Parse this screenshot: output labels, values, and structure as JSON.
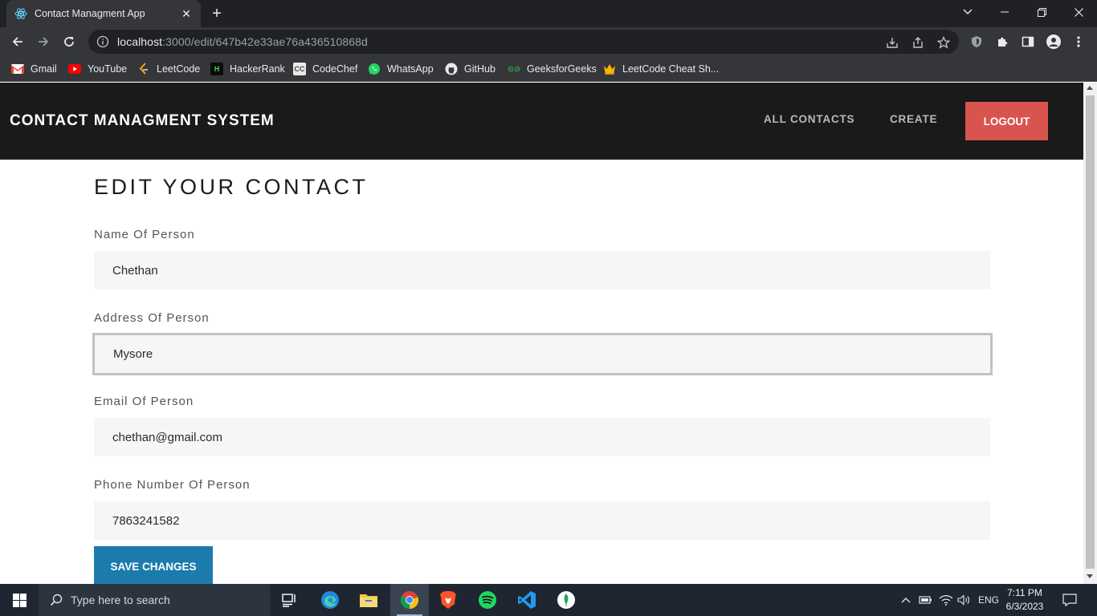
{
  "browser": {
    "tab_title": "Contact Managment App",
    "url_host": "localhost",
    "url_rest": ":3000/edit/647b42e33ae76a436510868d",
    "bookmarks": [
      {
        "label": "Gmail",
        "icon": "gmail-icon"
      },
      {
        "label": "YouTube",
        "icon": "youtube-icon"
      },
      {
        "label": "LeetCode",
        "icon": "leetcode-icon"
      },
      {
        "label": "HackerRank",
        "icon": "hackerrank-icon"
      },
      {
        "label": "CodeChef",
        "icon": "codechef-icon"
      },
      {
        "label": "WhatsApp",
        "icon": "whatsapp-icon"
      },
      {
        "label": "GitHub",
        "icon": "github-icon"
      },
      {
        "label": "GeeksforGeeks",
        "icon": "geeksforgeeks-icon"
      },
      {
        "label": "LeetCode Cheat Sh...",
        "icon": "crown-icon"
      }
    ]
  },
  "app": {
    "brand": "CONTACT MANAGMENT SYSTEM",
    "nav": {
      "all_contacts": "ALL CONTACTS",
      "create": "CREATE",
      "logout": "LOGOUT"
    },
    "colors": {
      "header_bg": "#1a1a1a",
      "logout_bg": "#d9534f",
      "save_bg": "#1c7bad"
    }
  },
  "form": {
    "heading": "EDIT YOUR CONTACT",
    "name_label": "Name Of Person",
    "name_value": "Chethan",
    "address_label": "Address Of Person",
    "address_value": "Mysore",
    "email_label": "Email Of Person",
    "email_value": "chethan@gmail.com",
    "phone_label": "Phone Number Of Person",
    "phone_value": "7863241582",
    "save_label": "SAVE CHANGES"
  },
  "taskbar": {
    "search_placeholder": "Type here to search",
    "language": "ENG",
    "time": "7:11 PM",
    "date": "6/3/2023"
  }
}
